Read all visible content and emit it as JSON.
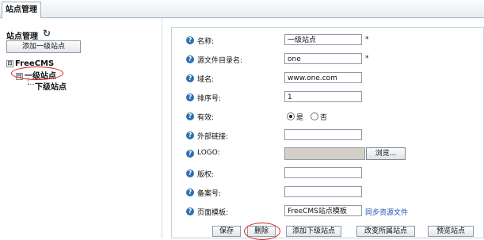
{
  "tab": {
    "label": "站点管理"
  },
  "sidebar": {
    "title": "站点管理",
    "refresh_icon": "refresh-icon",
    "add_top_button": "添加一级站点",
    "tree": {
      "root": {
        "toggle": "⊟",
        "label": "FreeCMS"
      },
      "level1": {
        "toggle": "⊟",
        "label": "一级站点"
      },
      "level2": {
        "label": "下级站点"
      }
    }
  },
  "form": {
    "name": {
      "label": "名称:",
      "value": "一级站点",
      "required": "*"
    },
    "source_dir": {
      "label": "源文件目录名:",
      "value": "one",
      "required": "*"
    },
    "domain": {
      "label": "域名:",
      "value": "www.one.com"
    },
    "order": {
      "label": "排序号:",
      "value": "1"
    },
    "enabled": {
      "label": "有效:",
      "options": [
        "是",
        "否"
      ],
      "selected": "是"
    },
    "external_link": {
      "label": "外部链接:",
      "value": ""
    },
    "logo": {
      "label": "LOGO:",
      "browse": "浏览..."
    },
    "copyright": {
      "label": "版权:",
      "value": ""
    },
    "icp": {
      "label": "备案号:",
      "value": ""
    },
    "template": {
      "label": "页面模板:",
      "value": "FreeCMS站点模板",
      "sync_link": "同步资源文件"
    }
  },
  "actions": {
    "save": "保存",
    "delete": "删除",
    "add_child": "添加下级站点",
    "change_parent": "改变所属站点",
    "preview": "预览站点"
  },
  "colors": {
    "annotation": "#d72020",
    "help_icon": "#2f6fb4",
    "link": "#1f4fb3"
  }
}
